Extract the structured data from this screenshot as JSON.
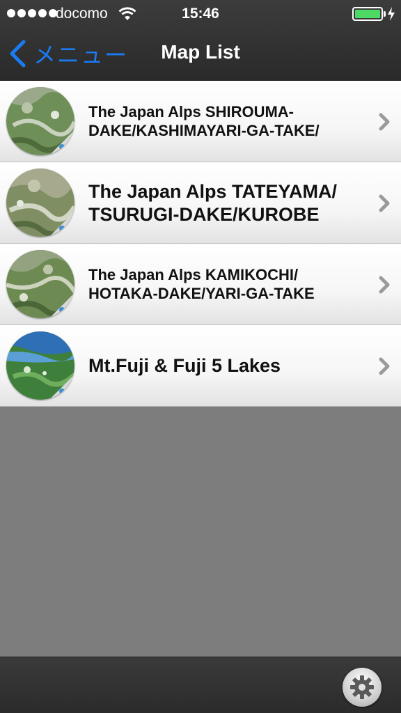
{
  "status_bar": {
    "carrier": "docomo",
    "time": "15:46",
    "battery_level": 1.0,
    "battery_color": "#4cd964",
    "icons": [
      "signal-dots-icon",
      "wifi-icon",
      "battery-icon",
      "charging-bolt-icon"
    ]
  },
  "nav": {
    "back_label": "メニュー",
    "back_icon": "chevron-left-icon",
    "title": "Map List",
    "accent_color": "#1a7cf5"
  },
  "map_list": {
    "items": [
      {
        "title_line1": "The Japan Alps SHIROUMA-",
        "title_line2": "DAKE/KASHIMAYARI-GA-TAKE/",
        "thumbnail": "mountain-aerial-map-thumbnail",
        "icon": "chevron-right-icon"
      },
      {
        "title_line1": "The Japan Alps TATEYAMA/",
        "title_line2": "TSURUGI-DAKE/KUROBE",
        "thumbnail": "mountain-aerial-map-thumbnail",
        "icon": "chevron-right-icon"
      },
      {
        "title_line1": "The Japan Alps KAMIKOCHI/",
        "title_line2": "HOTAKA-DAKE/YARI-GA-TAKE",
        "thumbnail": "mountain-aerial-map-thumbnail",
        "icon": "chevron-right-icon"
      },
      {
        "title_line1": "Mt.Fuji & Fuji 5 Lakes",
        "title_line2": "",
        "thumbnail": "lake-aerial-map-thumbnail",
        "icon": "chevron-right-icon"
      }
    ]
  },
  "toolbar": {
    "settings_icon": "gear-icon"
  }
}
